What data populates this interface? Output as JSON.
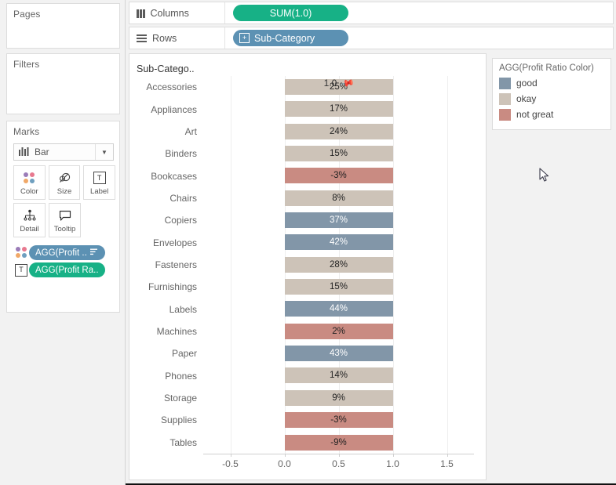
{
  "left_panel": {
    "pages": {
      "title": "Pages"
    },
    "filters": {
      "title": "Filters"
    },
    "marks": {
      "title": "Marks",
      "mark_type": "Bar",
      "mark_type_icon": "bar-chart-icon",
      "dropdown_icon": "chevron-down-icon",
      "buttons": [
        {
          "label": "Color",
          "icon": "color-dots-icon"
        },
        {
          "label": "Size",
          "icon": "size-circles-icon"
        },
        {
          "label": "Label",
          "icon": "text-label-icon"
        },
        {
          "label": "Detail",
          "icon": "detail-hierarchy-icon"
        },
        {
          "label": "Tooltip",
          "icon": "tooltip-bubble-icon"
        }
      ],
      "pills": [
        {
          "text": "AGG(Profit ..",
          "color": "#5c91b3",
          "icon": "color-dots-icon",
          "sort_icon": "sort-icon"
        },
        {
          "text": "AGG(Profit Ra..",
          "color": "#17b186",
          "icon": "text-label-icon",
          "sort_icon": ""
        }
      ]
    }
  },
  "shelves": {
    "columns": {
      "label": "Columns",
      "icon": "columns-icon",
      "pill": "SUM(1.0)",
      "pill_color": "#17b186"
    },
    "rows": {
      "label": "Rows",
      "icon": "rows-icon",
      "pill": "Sub-Category",
      "pill_color": "#5c91b3",
      "expand_icon": "plus-box-icon"
    }
  },
  "viz": {
    "field_header": "Sub-Catego..",
    "axis_title": "1.0",
    "axis_pin_icon": "pin-icon"
  },
  "legend": {
    "title": "AGG(Profit Ratio Color)",
    "items": [
      {
        "label": "good",
        "color": "#8296a8"
      },
      {
        "label": "okay",
        "color": "#cdc3b8"
      },
      {
        "label": "not great",
        "color": "#c98b82"
      }
    ]
  },
  "cursor": {
    "icon": "mouse-pointer-icon"
  },
  "chart_data": {
    "type": "bar",
    "title": "",
    "xlabel": "1.0",
    "ylabel": "Sub-Catego..",
    "xlim": [
      -0.75,
      1.75
    ],
    "xticks": [
      -0.5,
      0.0,
      0.5,
      1.0,
      1.5
    ],
    "xtick_labels": [
      "-0.5",
      "0.0",
      "0.5",
      "1.0",
      "1.5"
    ],
    "grid": true,
    "legend_position": "right",
    "bar_extent": {
      "start": 0.0,
      "end": 1.0
    },
    "note": "All bars are constant-width SUM(1.0) bars from 0.0 to 1.0; color encodes Profit Ratio band, label shows profit ratio percent",
    "categories": [
      "Accessories",
      "Appliances",
      "Art",
      "Binders",
      "Bookcases",
      "Chairs",
      "Copiers",
      "Envelopes",
      "Fasteners",
      "Furnishings",
      "Labels",
      "Machines",
      "Paper",
      "Phones",
      "Storage",
      "Supplies",
      "Tables"
    ],
    "values": [
      25,
      17,
      24,
      15,
      -3,
      8,
      37,
      42,
      28,
      15,
      44,
      2,
      43,
      14,
      9,
      -3,
      -9
    ],
    "value_labels": [
      "25%",
      "17%",
      "24%",
      "15%",
      "-3%",
      "8%",
      "37%",
      "42%",
      "28%",
      "15%",
      "44%",
      "2%",
      "43%",
      "14%",
      "9%",
      "-3%",
      "-9%"
    ],
    "color_bands": [
      "okay",
      "okay",
      "okay",
      "okay",
      "not great",
      "okay",
      "good",
      "good",
      "okay",
      "okay",
      "good",
      "not great",
      "good",
      "okay",
      "okay",
      "not great",
      "not great"
    ],
    "colors": [
      "#cdc3b8",
      "#cdc3b8",
      "#cdc3b8",
      "#cdc3b8",
      "#c98b82",
      "#cdc3b8",
      "#8296a8",
      "#8296a8",
      "#cdc3b8",
      "#cdc3b8",
      "#8296a8",
      "#c98b82",
      "#8296a8",
      "#cdc3b8",
      "#cdc3b8",
      "#c98b82",
      "#c98b82"
    ]
  }
}
